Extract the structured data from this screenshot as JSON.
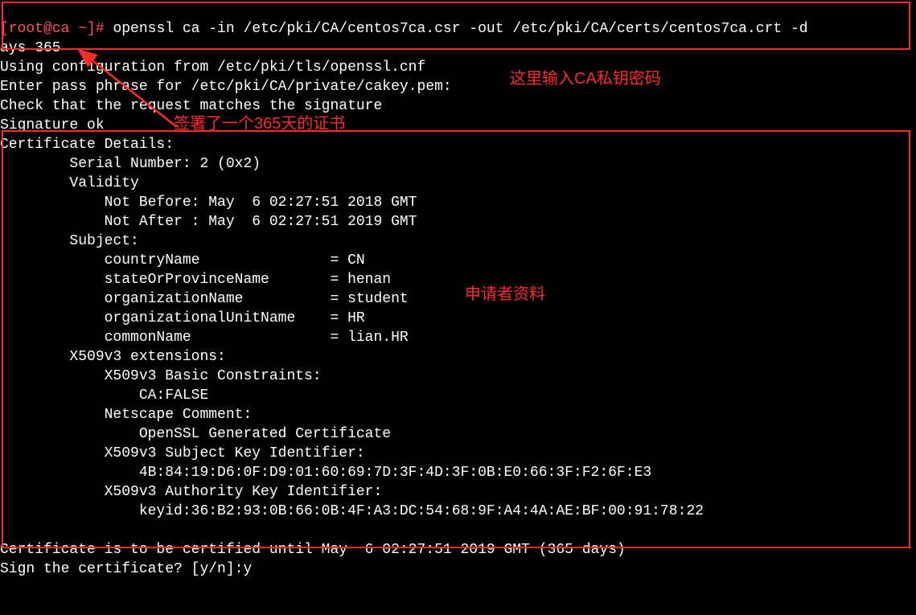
{
  "prompt": {
    "userhost": "[root@ca ~]# ",
    "command": "openssl ca -in /etc/pki/CA/centos7ca.csr -out /etc/pki/CA/certs/centos7ca.crt -days 365"
  },
  "output": {
    "l1": "Using configuration from /etc/pki/tls/openssl.cnf",
    "l2": "Enter pass phrase for /etc/pki/CA/private/cakey.pem:",
    "l3": "Check that the request matches the signature",
    "l4": "Signature ok",
    "l5": "Certificate Details:",
    "l6": "        Serial Number: 2 (0x2)",
    "l7": "        Validity",
    "l8": "            Not Before: May  6 02:27:51 2018 GMT",
    "l9": "            Not After : May  6 02:27:51 2019 GMT",
    "l10": "        Subject:",
    "l11": "            countryName               = CN",
    "l12": "            stateOrProvinceName       = henan",
    "l13": "            organizationName          = student",
    "l14": "            organizationalUnitName    = HR",
    "l15": "            commonName                = lian.HR",
    "l16": "        X509v3 extensions:",
    "l17": "            X509v3 Basic Constraints: ",
    "l18": "                CA:FALSE",
    "l19": "            Netscape Comment: ",
    "l20": "                OpenSSL Generated Certificate",
    "l21": "            X509v3 Subject Key Identifier: ",
    "l22": "                4B:84:19:D6:0F:D9:01:60:69:7D:3F:4D:3F:0B:E0:66:3F:F2:6F:E3",
    "l23": "            X509v3 Authority Key Identifier: ",
    "l24": "                keyid:36:B2:93:0B:66:0B:4F:A3:DC:54:68:9F:A4:4A:AE:BF:00:91:78:22",
    "blank": "",
    "l25": "Certificate is to be certified until May  6 02:27:51 2019 GMT (365 days)",
    "l26": "Sign the certificate? [y/n]:y"
  },
  "annotations": {
    "a1": "这里输入CA私钥密码",
    "a2": "签署了一个365天的证书",
    "a3": "申请者资料"
  }
}
